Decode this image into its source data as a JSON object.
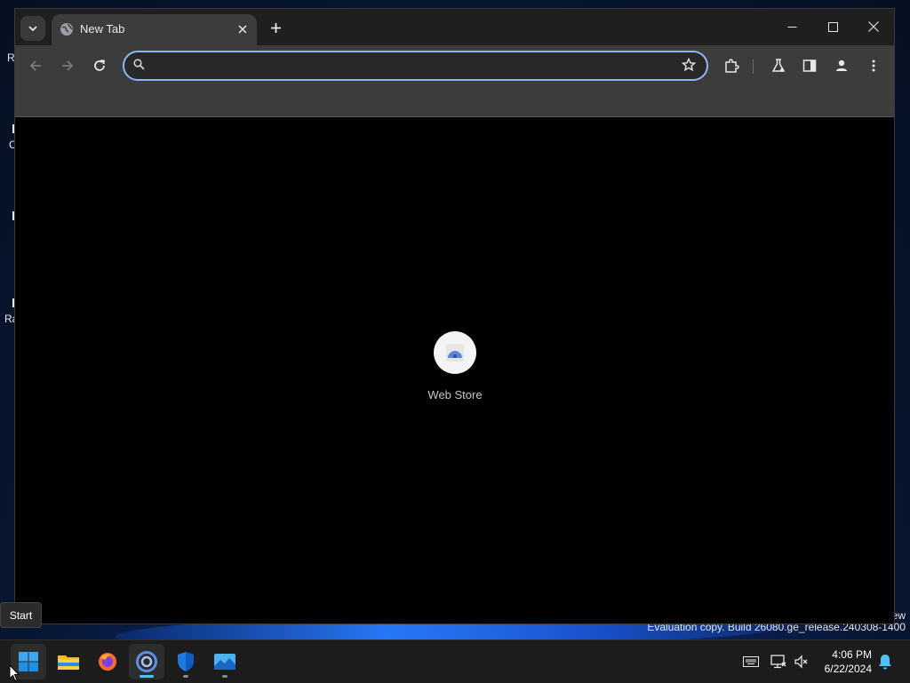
{
  "browser": {
    "tab": {
      "title": "New Tab"
    },
    "omnibox": {
      "value": "",
      "placeholder": ""
    },
    "shortcuts": [
      {
        "label": "Web Store"
      }
    ]
  },
  "desktop": {
    "watermark": "Evaluation copy. Build 26080.ge_release.240308-1400",
    "watermark_fragment": "ew",
    "icon_label_fragments": [
      "R",
      "C",
      "Ra"
    ],
    "start_tooltip": "Start"
  },
  "taskbar": {
    "apps": [
      {
        "name": "start",
        "icon": "windows-logo-icon"
      },
      {
        "name": "file-explorer",
        "icon": "folder-icon"
      },
      {
        "name": "firefox",
        "icon": "firefox-icon"
      },
      {
        "name": "chrome",
        "icon": "chrome-icon",
        "active": true
      },
      {
        "name": "defender",
        "icon": "shield-icon"
      },
      {
        "name": "photos",
        "icon": "photos-icon"
      }
    ],
    "clock": {
      "time": "4:06 PM",
      "date": "6/22/2024"
    }
  },
  "colors": {
    "accent": "#8fb4f8",
    "tab_active": "#3c3c3c",
    "taskbar_indicator": "#4cc2ff"
  }
}
